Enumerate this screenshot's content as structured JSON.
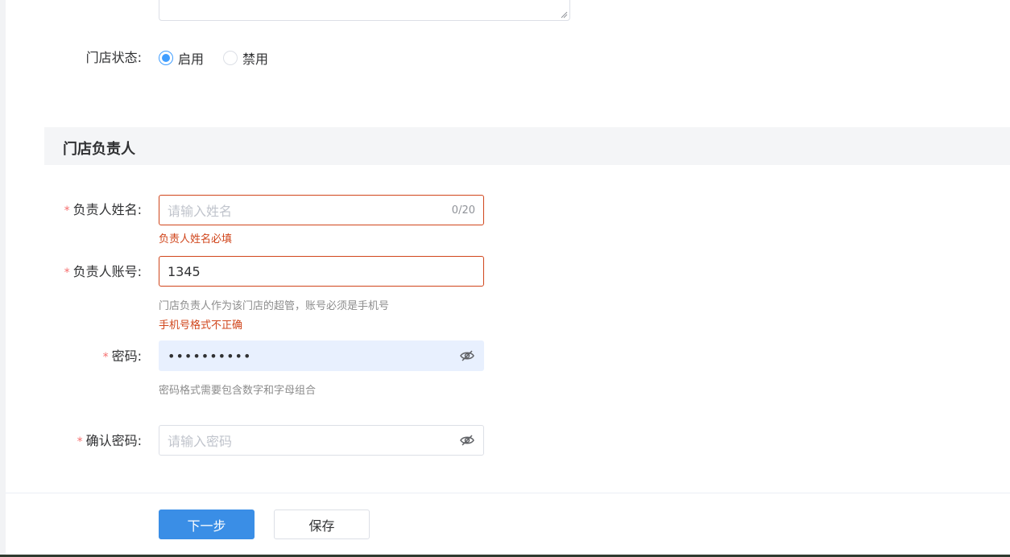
{
  "store_status": {
    "label": "门店状态:",
    "options": [
      {
        "label": "启用",
        "checked": true
      },
      {
        "label": "禁用",
        "checked": false
      }
    ]
  },
  "section": {
    "title": "门店负责人"
  },
  "manager_name": {
    "required_mark": "*",
    "label": "负责人姓名:",
    "placeholder": "请输入姓名",
    "counter": "0/20",
    "error": "负责人姓名必填"
  },
  "manager_account": {
    "required_mark": "*",
    "label": "负责人账号:",
    "value": "1345",
    "hint": "门店负责人作为该门店的超管，账号必须是手机号",
    "error": "手机号格式不正确"
  },
  "password": {
    "required_mark": "*",
    "label": "密码:",
    "masked_value": "••••••••••",
    "hint": "密码格式需要包含数字和字母组合",
    "icon": "eye-off-icon"
  },
  "confirm_password": {
    "required_mark": "*",
    "label": "确认密码:",
    "placeholder": "请输入密码",
    "icon": "eye-off-icon"
  },
  "footer": {
    "next_label": "下一步",
    "save_label": "保存"
  },
  "colors": {
    "primary": "#3a8ee6",
    "error": "#d0451b",
    "section_bg": "#f4f5f7"
  }
}
